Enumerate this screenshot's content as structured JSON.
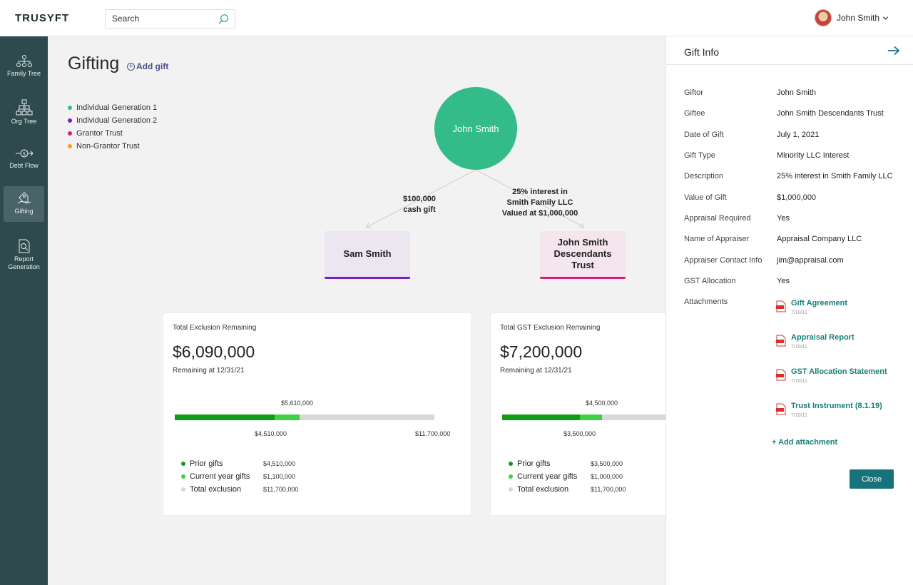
{
  "brand": "TRUSYFT",
  "search": {
    "placeholder": "Search"
  },
  "user": {
    "name": "John Smith"
  },
  "sidebar": {
    "items": [
      {
        "label": "Family Tree",
        "icon": "family-tree-icon"
      },
      {
        "label": "Org Tree",
        "icon": "org-tree-icon"
      },
      {
        "label": "Debt Flow",
        "icon": "debt-flow-icon"
      },
      {
        "label": "Gifting",
        "icon": "gifting-icon",
        "active": true
      },
      {
        "label": "Report Generation",
        "icon": "report-icon"
      }
    ]
  },
  "main": {
    "title": "Gifting",
    "add_gift_label": "Add gift",
    "legend": [
      {
        "label": "Individual Generation 1",
        "color": "#33bc89"
      },
      {
        "label": "Individual Generation 2",
        "color": "#7a1fc2"
      },
      {
        "label": "Grantor Trust",
        "color": "#d81b7f"
      },
      {
        "label": "Non-Grantor Trust",
        "color": "#f5a31a"
      }
    ],
    "tree": {
      "root": "John Smith",
      "children": [
        {
          "name": "Sam Smith",
          "edge_label": [
            "$100,000",
            "cash gift"
          ]
        },
        {
          "name": "John Smith Descendants Trust",
          "edge_label": [
            "25% interest in",
            "Smith Family LLC",
            "Valued at $1,000,000"
          ]
        }
      ]
    },
    "cards": [
      {
        "title": "Total Exclusion Remaining",
        "amount": "$6,090,000",
        "subtitle": "Remaining at 12/31/21",
        "bar": {
          "prior": 4510000,
          "current": 1100000,
          "total": 11700000
        },
        "top_label": "$5,610,000",
        "prior_label": "$4,510,000",
        "total_label": "$11,700,000",
        "legend": [
          {
            "name": "Prior gifts",
            "value": "$4,510,000",
            "color": "#129b17"
          },
          {
            "name": "Current year gifts",
            "value": "$1,100,000",
            "color": "#3fd142"
          },
          {
            "name": "Total exclusion",
            "value": "$11,700,000",
            "color": "#d7d7d7"
          }
        ]
      },
      {
        "title": "Total GST Exclusion Remaining",
        "amount": "$7,200,000",
        "subtitle": "Remaining at 12/31/21",
        "bar": {
          "prior": 3500000,
          "current": 1000000,
          "total": 11700000
        },
        "top_label": "$4,500,000",
        "prior_label": "$3,500,000",
        "legend": [
          {
            "name": "Prior gifts",
            "value": "$3,500,000",
            "color": "#129b17"
          },
          {
            "name": "Current year gifts",
            "value": "$1,000,000",
            "color": "#3fd142"
          },
          {
            "name": "Total exclusion",
            "value": "$11,700,000",
            "color": "#d7d7d7"
          }
        ]
      }
    ]
  },
  "panel": {
    "title": "Gift Info",
    "fields": [
      {
        "label": "Giftor",
        "value": "John Smith"
      },
      {
        "label": "Giftee",
        "value": "John Smith Descendants Trust"
      },
      {
        "label": "Date of Gift",
        "value": "July 1, 2021"
      },
      {
        "label": "Gift Type",
        "value": "Minority LLC Interest"
      },
      {
        "label": "Description",
        "value": "25% interest in Smith Family LLC"
      },
      {
        "label": "Value of Gift",
        "value": "$1,000,000"
      },
      {
        "label": "Appraisal Required",
        "value": "Yes"
      },
      {
        "label": "Name of Appraiser",
        "value": "Appraisal Company LLC"
      },
      {
        "label": "Appraiser Contact Info",
        "value": "jim@appraisal.com"
      },
      {
        "label": "GST Allocation",
        "value": "Yes"
      },
      {
        "label": "Attachments",
        "value": ""
      }
    ],
    "attachments": [
      {
        "name": "Gift Agreement",
        "date": "7/10/11"
      },
      {
        "name": "Appraisal Report",
        "date": "7/10/11"
      },
      {
        "name": "GST Allocation Statement",
        "date": "7/10/11"
      },
      {
        "name": "Trust Instrument (8.1.19)",
        "date": "7/10/11"
      }
    ],
    "add_attachment_label": "+ Add attachment",
    "close_label": "Close"
  }
}
